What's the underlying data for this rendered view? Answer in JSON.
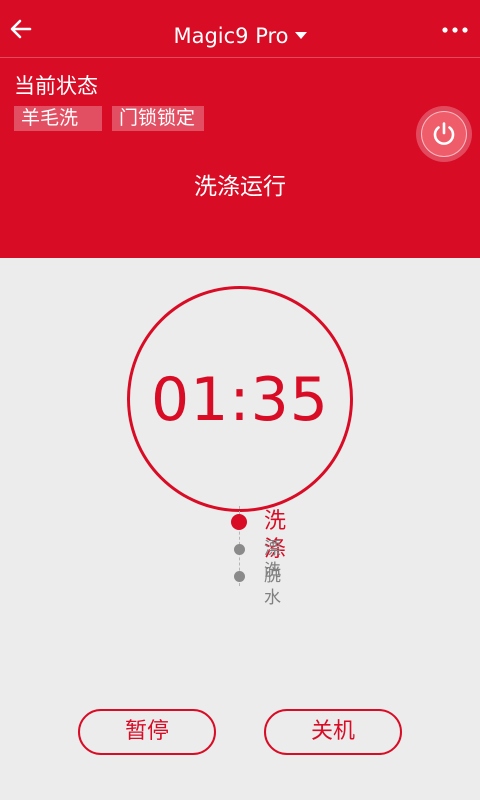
{
  "header": {
    "title": "Magic9 Pro",
    "back_icon": "arrow-left-icon",
    "more_icon": "more-dots-icon",
    "caret_icon": "caret-down-icon"
  },
  "status": {
    "label": "当前状态",
    "tags": [
      "羊毛洗",
      "门锁锁定"
    ],
    "running_text": "洗涤运行",
    "power_icon": "power-icon"
  },
  "timer": {
    "time": "01:35"
  },
  "steps": [
    {
      "label": "洗涤",
      "active": true
    },
    {
      "label": "漂洗",
      "active": false
    },
    {
      "label": "脱水",
      "active": false
    }
  ],
  "actions": {
    "pause_label": "暂停",
    "off_label": "关机"
  },
  "colors": {
    "accent": "#d90c26",
    "background": "#ececec",
    "inactive": "#8a8a8a"
  }
}
